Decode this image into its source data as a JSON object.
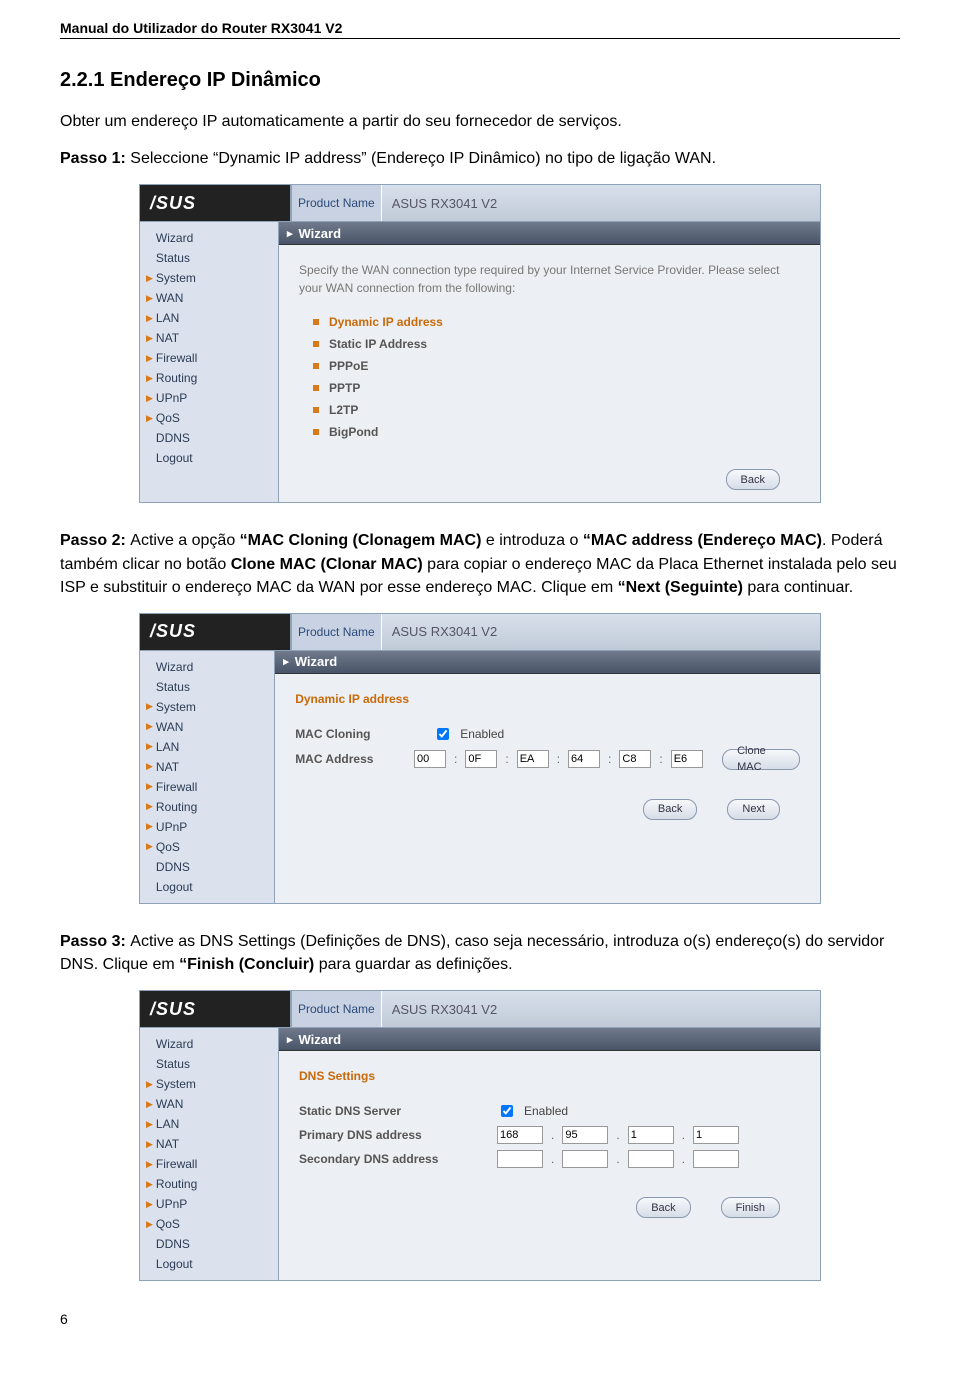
{
  "doc": {
    "header": "Manual do Utilizador do Router RX3041 V2",
    "section_title": "2.2.1 Endereço IP Dinâmico",
    "intro": "Obter um endereço IP automaticamente a partir do seu fornecedor de serviços.",
    "step1_label": "Passo 1: ",
    "step1_text": "Seleccione “Dynamic IP address” (Endereço IP Dinâmico) no tipo de ligação WAN.",
    "step2_label": "Passo 2: ",
    "step2_a": "Active a opção ",
    "step2_b": "“MAC Cloning (Clonagem MAC)",
    "step2_c": " e introduza o ",
    "step2_d": "“MAC address (Endereço MAC)",
    "step2_e": ". Poderá também clicar no botão ",
    "step2_f": "Clone MAC (Clonar MAC)",
    "step2_g": " para copiar o endereço MAC da Placa Ethernet instalada pelo seu ISP e substituir o endereço MAC da WAN por esse endereço MAC. Clique em ",
    "step2_h": "“Next (Seguinte)",
    "step2_i": " para continuar.",
    "step3_label": "Passo 3: ",
    "step3_a": "Active as DNS Settings (Definições de DNS), caso seja necessário, introduza o(s) endereço(s) do servidor DNS. Clique em ",
    "step3_b": "“Finish (Concluir)",
    "step3_c": " para guardar as definições.",
    "page_num": "6"
  },
  "router": {
    "logo": "/SUS",
    "product_label": "Product Name",
    "product_name": "ASUS RX3041 V2",
    "wizard": "Wizard",
    "nav": [
      "Wizard",
      "Status",
      "System",
      "WAN",
      "LAN",
      "NAT",
      "Firewall",
      "Routing",
      "UPnP",
      "QoS",
      "DDNS",
      "Logout"
    ],
    "panel1": {
      "intro": "Specify the WAN connection type required by your Internet Service Provider. Please select your WAN connection from the following:",
      "opts": [
        "Dynamic IP address",
        "Static IP Address",
        "PPPoE",
        "PPTP",
        "L2TP",
        "BigPond"
      ],
      "back": "Back"
    },
    "panel2": {
      "title": "Dynamic IP address",
      "mac_cloning": "MAC Cloning",
      "enabled": "Enabled",
      "mac_address": "MAC Address",
      "mac": [
        "00",
        "0F",
        "EA",
        "64",
        "C8",
        "E6"
      ],
      "clone": "Clone MAC",
      "back": "Back",
      "next": "Next"
    },
    "panel3": {
      "title": "DNS Settings",
      "static": "Static DNS Server",
      "enabled": "Enabled",
      "primary": "Primary DNS address",
      "secondary": "Secondary DNS address",
      "ip": [
        "168",
        "95",
        "1",
        "1"
      ],
      "back": "Back",
      "finish": "Finish"
    }
  }
}
